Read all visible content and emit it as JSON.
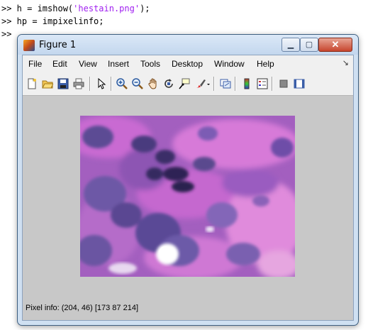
{
  "console": {
    "prompt": ">>",
    "line1_pre": " h = imshow(",
    "line1_str": "'hestain.png'",
    "line1_post": ");",
    "line2": " hp = impixelinfo;",
    "line3": ""
  },
  "window": {
    "title": "Figure 1",
    "minimize_glyph": "▁",
    "maximize_glyph": "▢",
    "close_glyph": "✕"
  },
  "menu": {
    "items": [
      "File",
      "Edit",
      "View",
      "Insert",
      "Tools",
      "Desktop",
      "Window",
      "Help"
    ],
    "dock_glyph": "↘"
  },
  "toolbar": {
    "icons": [
      "new-figure-icon",
      "open-file-icon",
      "save-icon",
      "print-icon",
      "edit-plot-icon",
      "zoom-in-icon",
      "zoom-out-icon",
      "pan-icon",
      "rotate-3d-icon",
      "data-cursor-icon",
      "brush-icon",
      "link-plot-icon",
      "insert-colorbar-icon",
      "insert-legend-icon",
      "hide-plot-tools-icon",
      "show-plot-tools-icon"
    ]
  },
  "image": {
    "description_icon": "stained-tissue-image"
  },
  "status": {
    "pixel_info": "Pixel info: (204, 46)  [173 87 214]"
  },
  "colors": {
    "figure_background": "#c8c8c8",
    "title_bar": "#cfe0f2",
    "close_button": "#c7452e",
    "string_literal": "#a020f0"
  }
}
